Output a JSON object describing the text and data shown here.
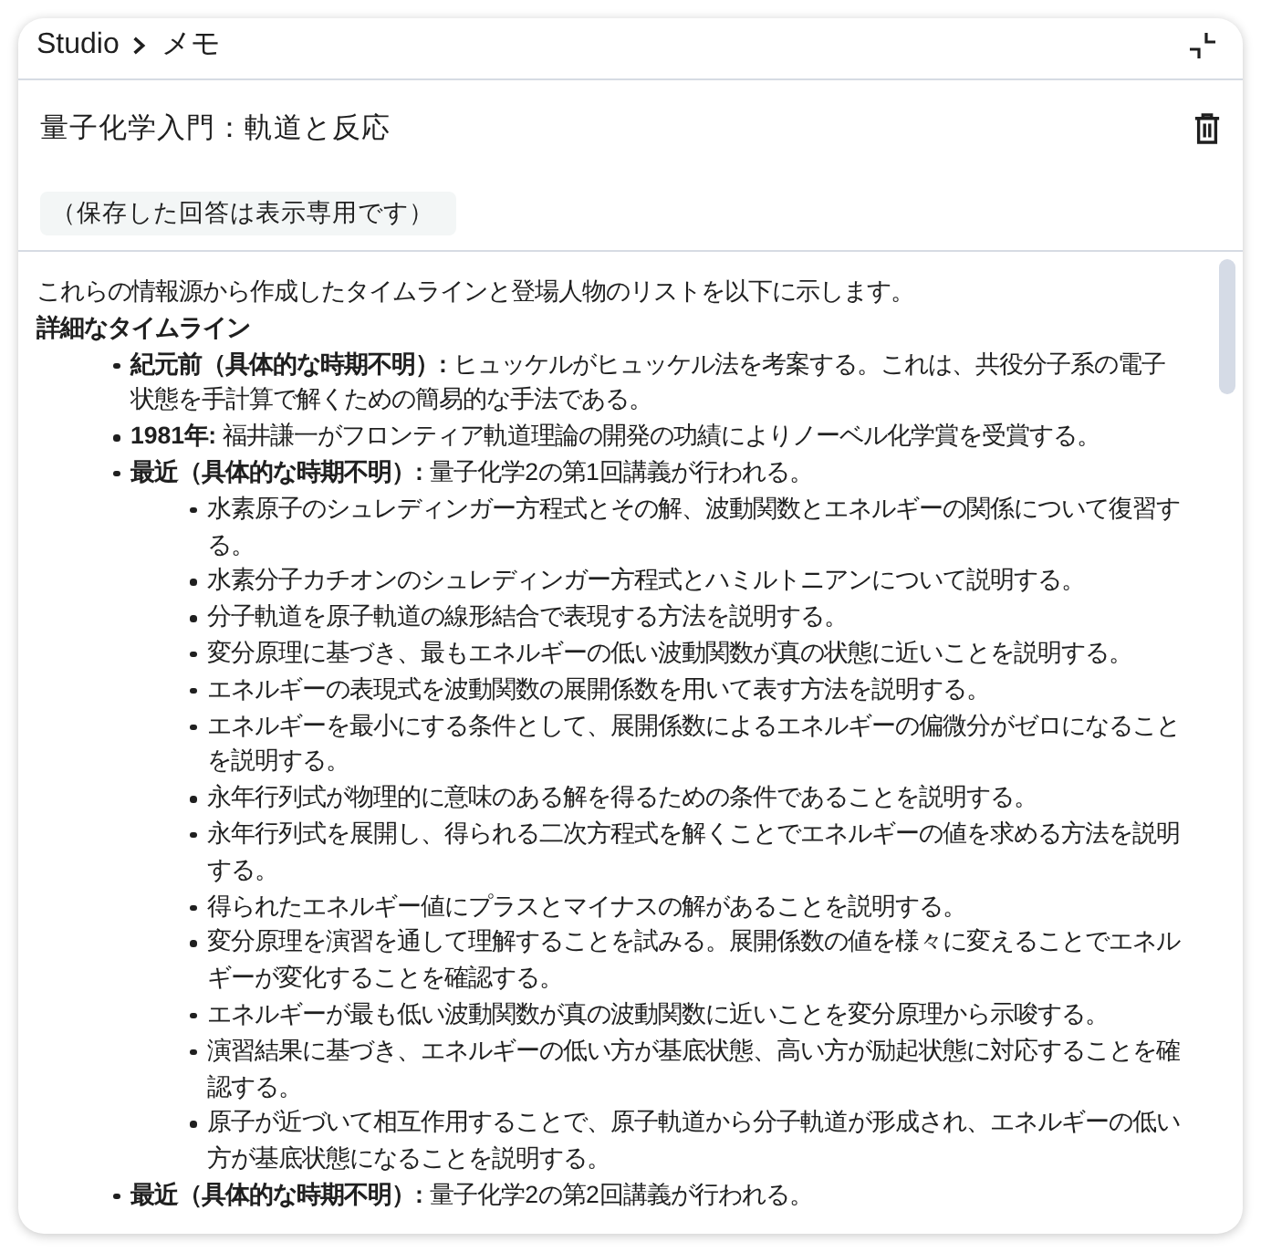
{
  "breadcrumb": {
    "root": "Studio",
    "current": "メモ"
  },
  "note": {
    "title": "量子化学入門：軌道と反応",
    "badge": "（保存した回答は表示専用です）"
  },
  "content": {
    "intro": "これらの情報源から作成したタイムラインと登場人物のリストを以下に示します。",
    "heading": "詳細なタイムライン",
    "items": [
      {
        "text": "**紀元前（具体的な時期不明）:** ヒュッケルがヒュッケル法を考案する。これは、共役分子系の電子状態を手計算で解くための簡易的な手法である。"
      },
      {
        "text": "**1981年:** 福井謙一がフロンティア軌道理論の開発の功績によりノーベル化学賞を受賞する。"
      },
      {
        "text": "**最近（具体的な時期不明）:** 量子化学2の第1回講義が行われる。",
        "children": [
          {
            "text": "水素原子のシュレディンガー方程式とその解、波動関数とエネルギーの関係について復習する。"
          },
          {
            "text": "水素分子カチオンのシュレディンガー方程式とハミルトニアンについて説明する。"
          },
          {
            "text": "分子軌道を原子軌道の線形結合で表現する方法を説明する。"
          },
          {
            "text": "変分原理に基づき、最もエネルギーの低い波動関数が真の状態に近いことを説明する。"
          },
          {
            "text": "エネルギーの表現式を波動関数の展開係数を用いて表す方法を説明する。"
          },
          {
            "text": "エネルギーを最小にする条件として、展開係数によるエネルギーの偏微分がゼロになることを説明する。"
          },
          {
            "text": "永年行列式が物理的に意味のある解を得るための条件であることを説明する。"
          },
          {
            "text": "永年行列式を展開し、得られる二次方程式を解くことでエネルギーの値を求める方法を説明する。"
          },
          {
            "text": "得られたエネルギー値にプラスとマイナスの解があることを説明する。"
          },
          {
            "text": "変分原理を演習を通して理解することを試みる。展開係数の値を様々に変えることでエネルギーが変化することを確認する。"
          },
          {
            "text": "エネルギーが最も低い波動関数が真の波動関数に近いことを変分原理から示唆する。"
          },
          {
            "text": "演習結果に基づき、エネルギーの低い方が基底状態、高い方が励起状態に対応することを確認する。"
          },
          {
            "text": "原子が近づいて相互作用することで、原子軌道から分子軌道が形成され、エネルギーの低い方が基底状態になることを説明する。"
          }
        ]
      },
      {
        "text": "**最近（具体的な時期不明）:** 量子化学2の第2回講義が行われる。"
      }
    ]
  }
}
